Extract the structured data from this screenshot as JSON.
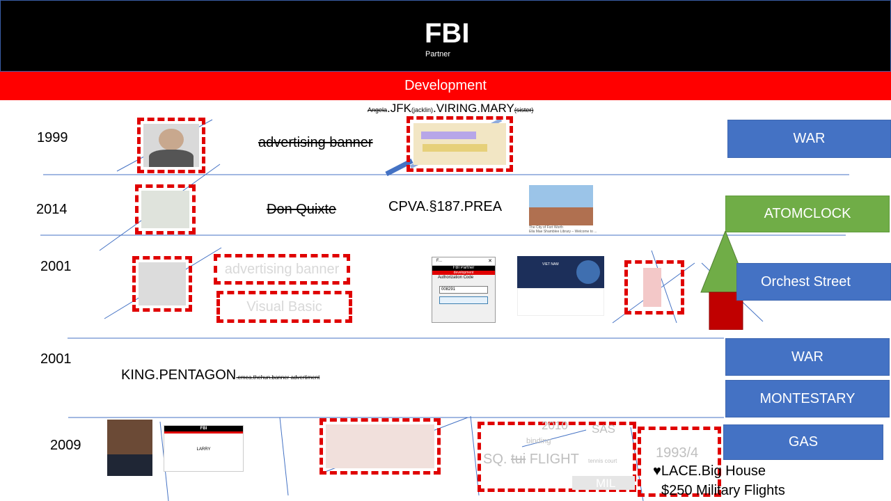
{
  "header": {
    "title": "FBI",
    "subtitle": "Partner"
  },
  "section_bar": {
    "label": "Development"
  },
  "top_caption": {
    "prefix": "Angela",
    "main1": ".JFK",
    "sub1": "(jacklin)",
    "main2": ".VIRING.MARY",
    "sub2": "(sister)"
  },
  "rows": {
    "r1": {
      "year": "1999",
      "text": "advertising banner"
    },
    "r2": {
      "year": "2014",
      "text": "Don Quixte",
      "code": "CPVA.§187.PREA",
      "caption1": "The City of Fort Worth",
      "caption2": "Ella Mae Shamblee Library – Welcome to ..."
    },
    "r3": {
      "year": "2001",
      "text1": "advertising banner",
      "text2": "Visual Basic",
      "dialog": {
        "title": "F...",
        "header1": "FBI Partner",
        "header2": "development",
        "label": "Authorization Code",
        "value": "008291"
      },
      "site_title": "VIET NAM"
    },
    "r4": {
      "year": "2001",
      "main": "KING.PENTAGON",
      "sub": ".emea.thehun.banner advertiment"
    },
    "r5": {
      "year": "2009",
      "thumb_title": "FBI",
      "thumb_name": "LARRY",
      "year2": "2010",
      "sas": "SAS",
      "binding": "binding",
      "flight_prefix": "SQ.",
      "flight_strike": "tui",
      "flight": "FLIGHT",
      "tennis": "tennis court",
      "mil": "MIL",
      "dates": "1993/4",
      "lace": "♥LACE.Big House",
      "money": "$250 Military Flights"
    }
  },
  "buttons": {
    "war1": "WAR",
    "atomclock": "ATOMCLOCK",
    "orchest": "Orchest Street",
    "war2": "WAR",
    "montestary": "MONTESTARY",
    "gas": "GAS"
  },
  "colors": {
    "red": "#ff0000",
    "blue": "#4472c4",
    "green": "#70ad47",
    "black": "#000000"
  }
}
